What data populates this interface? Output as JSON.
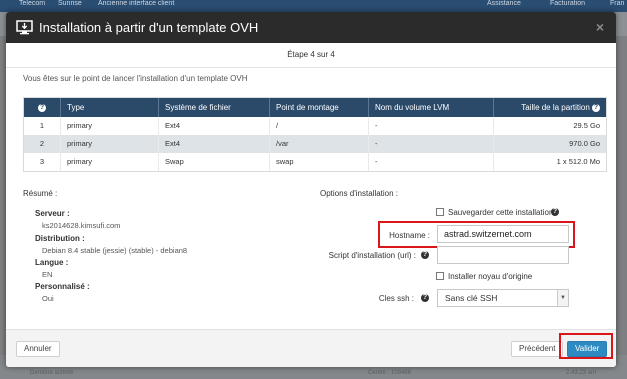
{
  "background": {
    "nav_left": [
      "Telecom",
      "Sunrise",
      "Ancienne interface client"
    ],
    "nav_right": [
      "Assistance",
      "Facturation",
      "Fran"
    ],
    "lower_text_1": "Dernière activité",
    "lower_text_2": "Centre : 103466",
    "lower_text_3": "2.43.23 am"
  },
  "modal": {
    "title": "Installation à partir d'un template OVH",
    "close_symbol": "×",
    "step": "Étape 4 sur 4",
    "intro": "Vous êtes sur le point de lancer l'installation d'un template OVH"
  },
  "partitions": {
    "headers": {
      "help": "?",
      "type": "Type",
      "filesystem": "Système de fichier",
      "mount": "Point de montage",
      "lvm": "Nom du volume LVM",
      "size": "Taille de la partition"
    },
    "rows": [
      {
        "num": "1",
        "type": "primary",
        "fs": "Ext4",
        "mount": "/",
        "lvm": "-",
        "size": "29.5 Go"
      },
      {
        "num": "2",
        "type": "primary",
        "fs": "Ext4",
        "mount": "/var",
        "lvm": "-",
        "size": "970.0 Go"
      },
      {
        "num": "3",
        "type": "primary",
        "fs": "Swap",
        "mount": "swap",
        "lvm": "-",
        "size": "1 x 512.0 Mo"
      }
    ]
  },
  "summary": {
    "title": "Résumé :",
    "server_label": "Serveur :",
    "server_value": "ks2014628.kimsufi.com",
    "distribution_label": "Distribution :",
    "distribution_value": "Debian 8.4 stable (jessie) (stable) - debian8",
    "language_label": "Langue :",
    "language_value": "EN",
    "custom_label": "Personnalisé :",
    "custom_value": "Oui"
  },
  "options": {
    "title": "Options d'installation :",
    "save_label": "Sauvegarder cette installation",
    "hostname_label": "Hostname :",
    "hostname_value": "astrad.switzernet.com",
    "script_label": "Script d'installation (url) :",
    "script_value": "",
    "kernel_label": "Installer noyau d'origine",
    "ssh_label": "Cles ssh :",
    "ssh_value": "Sans clé SSH"
  },
  "footer": {
    "cancel": "Annuler",
    "previous": "Précédent",
    "validate": "Valider"
  },
  "colors": {
    "header": "#2b2b2b",
    "table_header": "#2b4a6a",
    "primary_button": "#2e8bc1",
    "highlight": "#d8161c"
  }
}
